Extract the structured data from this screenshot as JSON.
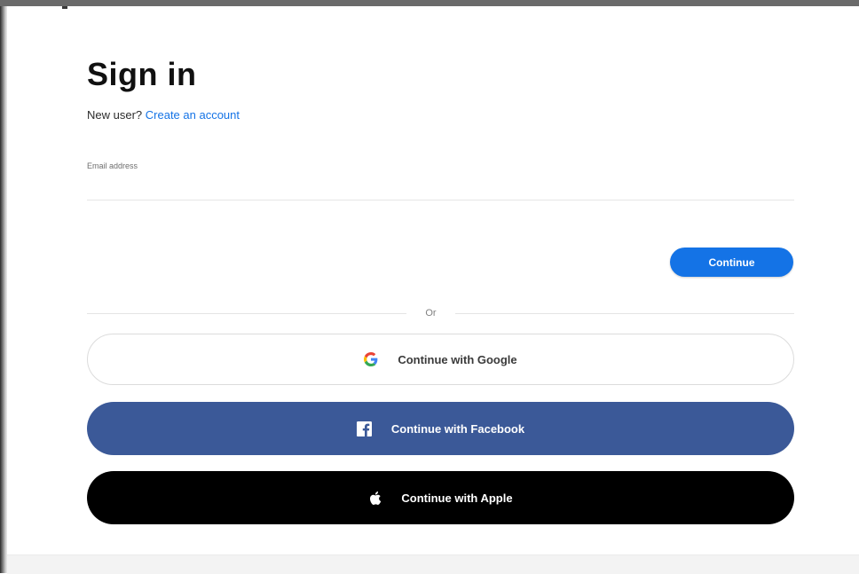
{
  "page": {
    "title": "Sign in",
    "new_user_prompt": "New user?",
    "create_account_link": "Create an account"
  },
  "email": {
    "label": "Email address",
    "value": "",
    "placeholder": ""
  },
  "actions": {
    "continue_label": "Continue",
    "divider_text": "Or"
  },
  "social": {
    "google_label": "Continue with Google",
    "facebook_label": "Continue with Facebook",
    "apple_label": "Continue with Apple"
  },
  "colors": {
    "accent_blue": "#1473e6",
    "facebook_blue": "#3b5998",
    "apple_black": "#000000",
    "google_blue": "#4285f4",
    "google_red": "#ea4335",
    "google_yellow": "#fbbc05",
    "google_green": "#34a853"
  },
  "icons": {
    "google": "google-g-icon",
    "facebook": "facebook-f-icon",
    "apple": "apple-logo-icon"
  }
}
